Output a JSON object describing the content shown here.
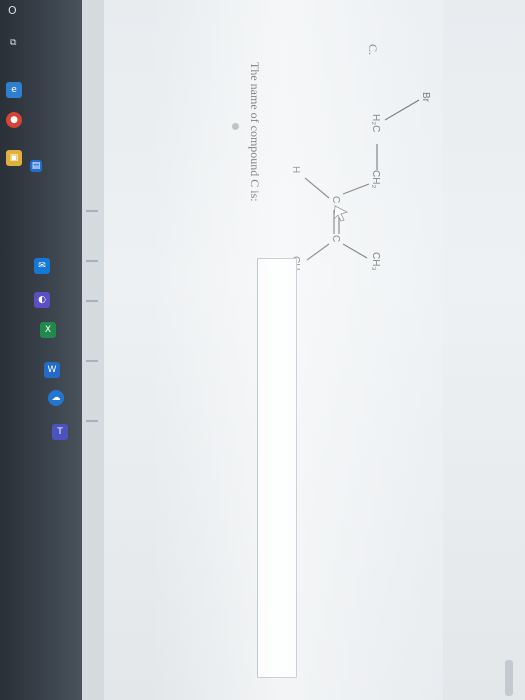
{
  "question": {
    "label": "C.",
    "prompt": "The name of compound C is:",
    "answer_value": ""
  },
  "structure": {
    "atoms": {
      "br": "Br",
      "h2c": "H₂C",
      "ch2": "CH₂",
      "c1": "C",
      "c2": "C",
      "h": "H",
      "ch3_top": "CH₃",
      "ch3_bottom": "CH₃"
    }
  },
  "taskbar": {
    "icons": [
      "start-icon",
      "task-view-icon",
      "edge-icon",
      "chrome-icon",
      "explorer-icon",
      "store-icon",
      "mail-icon",
      "photos-icon",
      "excel-icon",
      "word-icon"
    ]
  },
  "colors": {
    "taskbar": "#2f363e",
    "page": "#eef1f3",
    "answer_border": "#8fa0ab"
  }
}
